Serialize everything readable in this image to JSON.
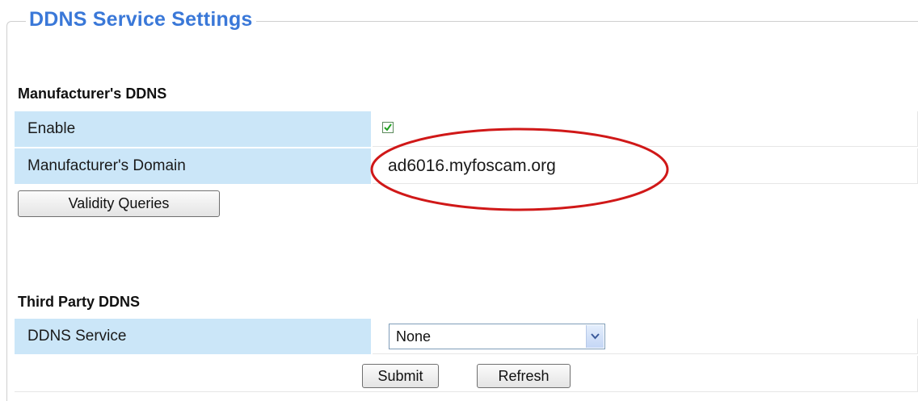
{
  "legend": "DDNS Service Settings",
  "manufacturer": {
    "title": "Manufacturer's DDNS",
    "enable_label": "Enable",
    "enable_checked": true,
    "domain_label": "Manufacturer's Domain",
    "domain_value": "ad6016.myfoscam.org",
    "validity_button": "Validity Queries"
  },
  "third_party": {
    "title": "Third Party DDNS",
    "service_label": "DDNS Service",
    "service_selected": "None"
  },
  "actions": {
    "submit": "Submit",
    "refresh": "Refresh"
  },
  "annotation_color": "#d01818"
}
